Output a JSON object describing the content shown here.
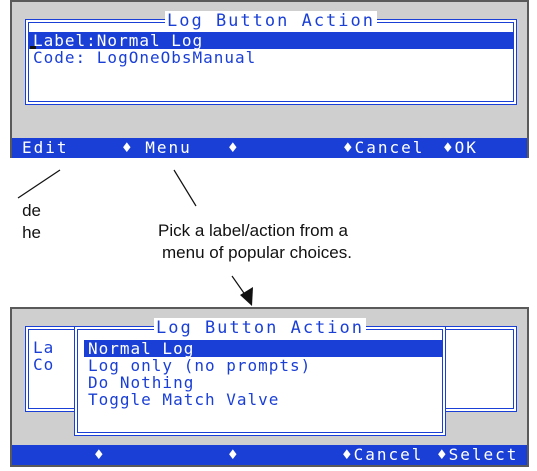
{
  "screen1": {
    "dialog_title": "Log Button Action",
    "rows": [
      {
        "label": "Label:Normal Log",
        "selected": true
      },
      {
        "label": "Code: LogOneObsManual",
        "selected": false
      }
    ],
    "menubar": {
      "edit": "Edit",
      "menu": "♦ Menu",
      "diamond": "♦",
      "cancel": "♦Cancel",
      "ok": "♦OK"
    }
  },
  "left_callout": {
    "line1": "de",
    "line2": "he"
  },
  "menu_callout": {
    "line1": "Pick a label/action from a",
    "line2": "menu of popular choices."
  },
  "screen2": {
    "dialog_title": "Log Button Action",
    "background_labels": [
      "La",
      "Co"
    ],
    "items": [
      {
        "label": "Normal Log",
        "selected": true
      },
      {
        "label": "Log only (no prompts)",
        "selected": false
      },
      {
        "label": "Do Nothing",
        "selected": false
      },
      {
        "label": "Toggle Match Valve",
        "selected": false
      }
    ],
    "menubar": {
      "diamond1": "♦",
      "diamond2": "♦",
      "cancel": "♦Cancel",
      "select": "♦Select"
    }
  },
  "colors": {
    "accent": "#1a3fd6",
    "screen_bg": "#cfcfcf",
    "dialog_bg": "#ffffff"
  }
}
